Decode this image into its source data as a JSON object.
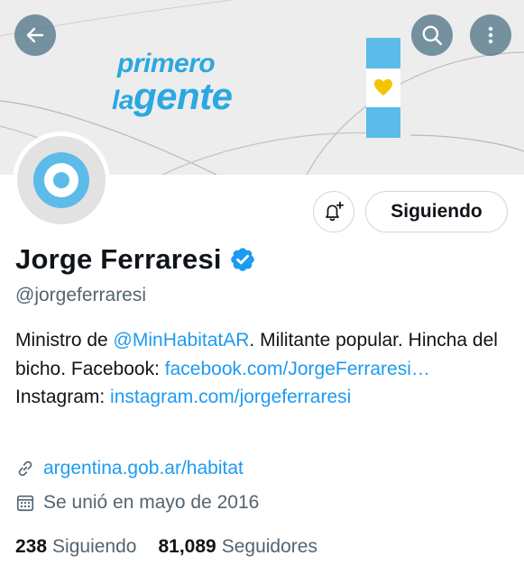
{
  "banner": {
    "slogan_line1": "primero",
    "slogan_line2_small": "la",
    "slogan_line2_big": "gente",
    "accent_color": "#2ba8e0",
    "flag_colors": {
      "blue": "#5dbbe9",
      "white": "#ffffff",
      "sun": "#f5c400"
    }
  },
  "header_buttons": {
    "back_icon": "arrow-left-icon",
    "search_icon": "search-icon",
    "more_icon": "more-vertical-icon"
  },
  "profile": {
    "name": "Jorge Ferraresi",
    "handle": "@jorgeferraresi",
    "verified": true,
    "avatar_icon": "argentina-roundel-icon"
  },
  "actions": {
    "notify_icon": "bell-plus-icon",
    "follow_label": "Siguiendo"
  },
  "bio": {
    "t1": "Ministro de ",
    "mention": "@MinHabitatAR",
    "t2": ". Militante popular. Hincha del bicho. Facebook: ",
    "facebook_link": "facebook.com/​JorgeFerraresi…",
    "t3": " Instagram: ",
    "instagram_link": "instagram.com/​jorgeferraresi"
  },
  "meta": {
    "website": "argentina.gob.ar/habitat",
    "joined": "Se unió en mayo de 2016"
  },
  "stats": {
    "following_count": "238",
    "following_label": "Siguiendo",
    "followers_count": "81,089",
    "followers_label": "Seguidores"
  },
  "colors": {
    "link": "#1d9bf0",
    "verified": "#1d9bf0",
    "secondary_text": "#536471"
  }
}
